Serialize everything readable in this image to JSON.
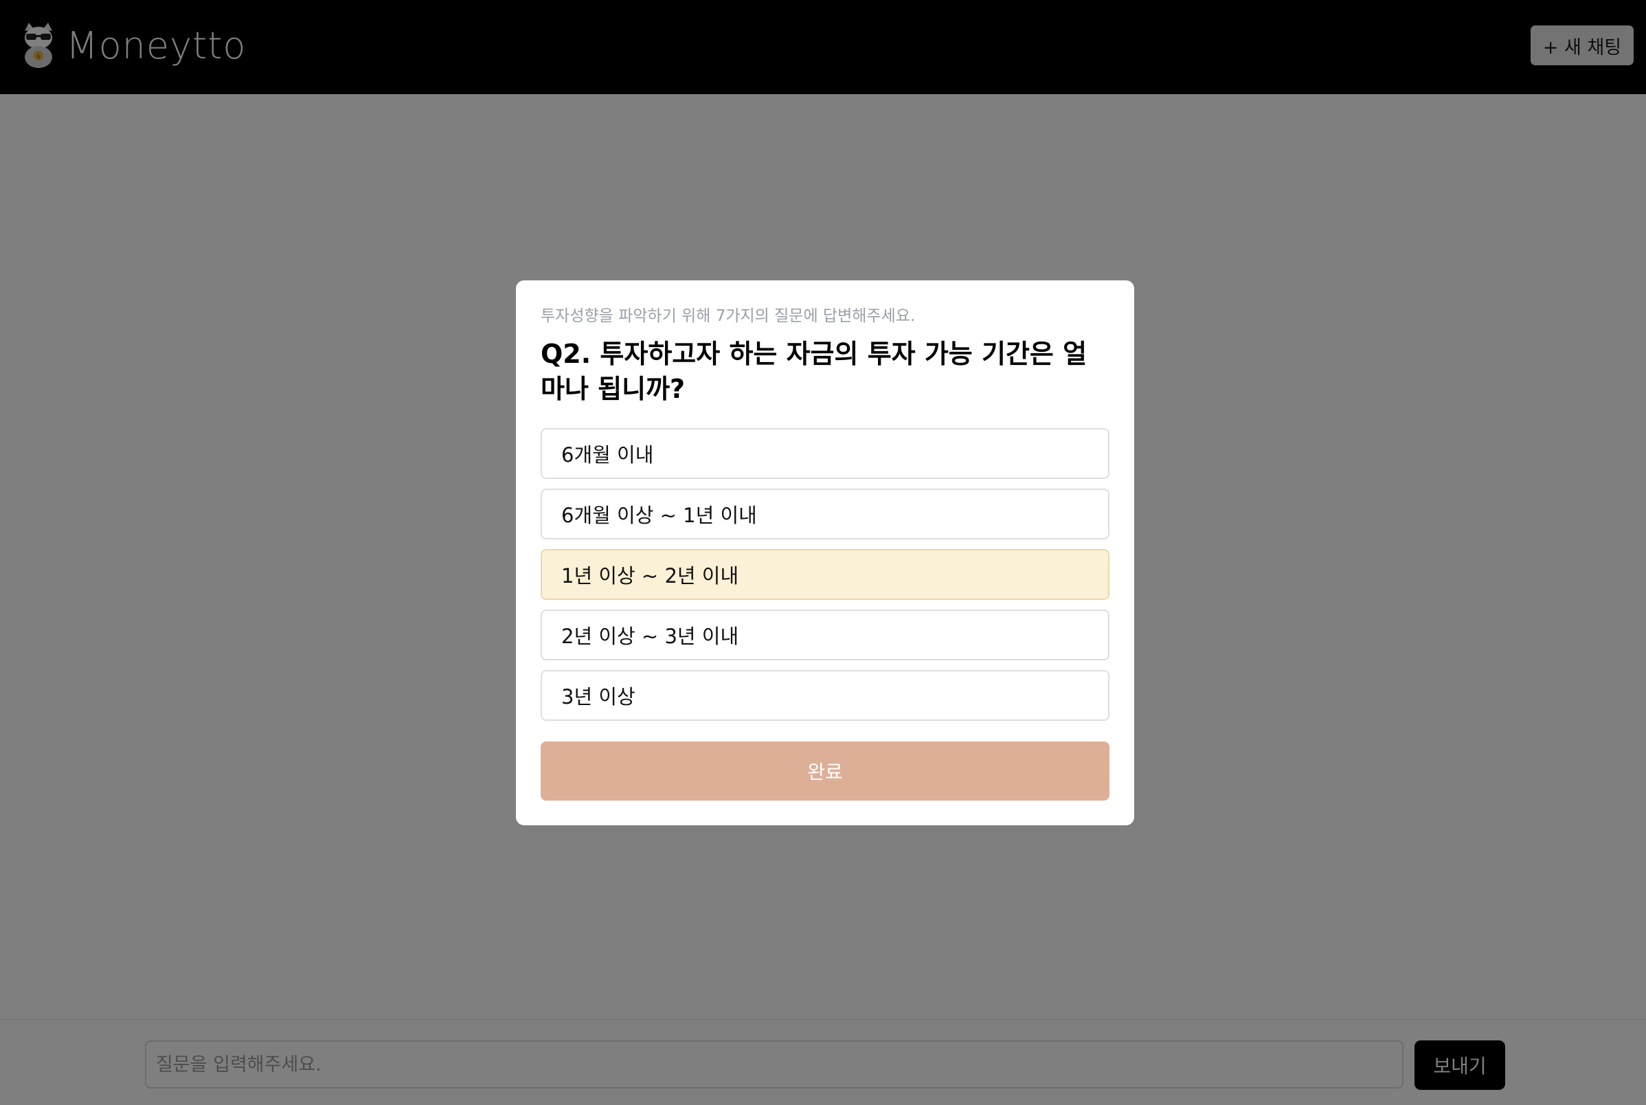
{
  "header": {
    "logo_text": "Moneytto",
    "logo_icon": "cat-with-sunglasses-logo",
    "new_chat_label": "+ 새 채팅"
  },
  "chat_input": {
    "placeholder": "질문을 입력해주세요.",
    "send_label": "보내기"
  },
  "modal": {
    "intro": "투자성향을 파악하기 위해 7가지의 질문에 답변해주세요.",
    "question": "Q2. 투자하고자 하는 자금의 투자 가능 기간은 얼마나 됩니까?",
    "options": [
      {
        "label": "6개월 이내",
        "selected": false
      },
      {
        "label": "6개월 이상 ~ 1년 이내",
        "selected": false
      },
      {
        "label": "1년 이상 ~ 2년 이내",
        "selected": true
      },
      {
        "label": "2년 이상 ~ 3년 이내",
        "selected": false
      },
      {
        "label": "3년 이상",
        "selected": false
      }
    ],
    "done_label": "완료"
  },
  "colors": {
    "header_bg": "#000000",
    "selected_option_bg": "#fbf1d6",
    "done_button_bg": "#ddaf97",
    "send_button_bg": "#000000"
  }
}
